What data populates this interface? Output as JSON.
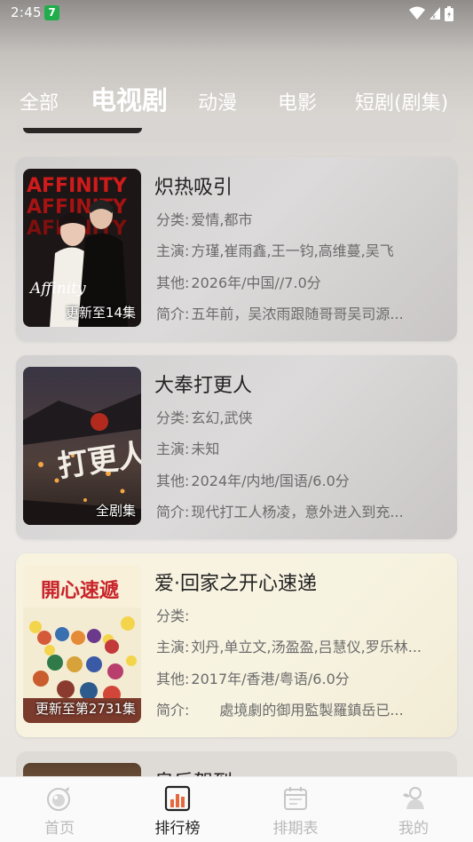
{
  "status_bar": {
    "time": "2:45",
    "app_badge": "7"
  },
  "tabs": [
    {
      "label": "全部",
      "active": false
    },
    {
      "label": "电视剧",
      "active": true
    },
    {
      "label": "动漫",
      "active": false
    },
    {
      "label": "电影",
      "active": false
    },
    {
      "label": "短剧(剧集)",
      "active": false
    }
  ],
  "items": [
    {
      "title": "炽热吸引",
      "genre_label": "分类:",
      "genre": "爱情,都市",
      "cast_label": "主演:",
      "cast": "方瑾,崔雨鑫,王一钧,高维蔓,吴飞",
      "other_label": "其他:",
      "other": "2026年/中国//7.0分",
      "summary_label": "简介:",
      "summary": "五年前，吴浓雨跟随哥哥吴司源...",
      "badge": "更新至14集",
      "poster_text": "AFFINITY"
    },
    {
      "title": "大奉打更人",
      "genre_label": "分类:",
      "genre": "玄幻,武侠",
      "cast_label": "主演:",
      "cast": "未知",
      "other_label": "其他:",
      "other": "2024年/内地/国语/6.0分",
      "summary_label": "简介:",
      "summary": "现代打工人杨凌，意外进入到充...",
      "badge": "全剧集",
      "poster_text": "打更人"
    },
    {
      "title": "爱·回家之开心速递",
      "genre_label": "分类:",
      "genre": "",
      "cast_label": "主演:",
      "cast": "刘丹,单立文,汤盈盈,吕慧仪,罗乐林...",
      "other_label": "其他:",
      "other": "2017年/香港/粤语/6.0分",
      "summary_label": "简介:",
      "summary": "　　處境劇的御用監製羅鎮岳已...",
      "badge": "更新至第2731集",
      "poster_text": "開心速遞"
    },
    {
      "title": "皇后驾到"
    }
  ],
  "bottom_nav": [
    {
      "label": "首页",
      "icon": "home-icon",
      "active": false
    },
    {
      "label": "排行榜",
      "icon": "ranking-icon",
      "active": true
    },
    {
      "label": "排期表",
      "icon": "schedule-icon",
      "active": false
    },
    {
      "label": "我的",
      "icon": "profile-icon",
      "active": false
    }
  ],
  "colors": {
    "badge_green": "#1fae4b",
    "active_nav": "#222222",
    "inactive_nav": "#b9b9b9",
    "nav_accent": "#e8683e"
  }
}
